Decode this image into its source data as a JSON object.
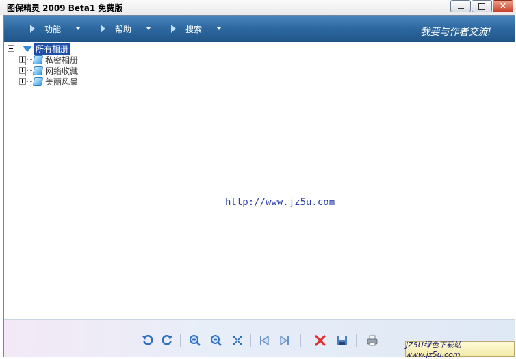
{
  "window": {
    "title": "图保精灵 2009 Beta1  免费版",
    "controls": {
      "minimize": "minimize-icon",
      "maximize": "maximize-icon",
      "close": "✕"
    }
  },
  "menubar": {
    "items": [
      {
        "label": "功能"
      },
      {
        "label": "帮助"
      },
      {
        "label": "搜索"
      }
    ],
    "contact_link": "我要与作者交流!"
  },
  "tree": {
    "root": {
      "label": "所有相册",
      "icon": "folder-open-icon"
    },
    "children": [
      {
        "label": "私密相册",
        "icon": "album-icon"
      },
      {
        "label": "网络收藏",
        "icon": "album-icon"
      },
      {
        "label": "美丽风景",
        "icon": "album-icon"
      }
    ]
  },
  "viewer": {
    "watermark": "http://www.jz5u.com"
  },
  "toolbar": {
    "buttons": [
      "rotate-left-icon",
      "rotate-right-icon",
      "zoom-in-icon",
      "zoom-out-icon",
      "fit-screen-icon",
      "previous-icon",
      "next-icon",
      "delete-icon",
      "save-icon",
      "print-icon"
    ],
    "badge": "JZ5U绿色下载站www.jz5u.com"
  },
  "colors": {
    "menubar": "#2f6aa3",
    "accent": "#3a89d8",
    "delete": "#e03030"
  }
}
